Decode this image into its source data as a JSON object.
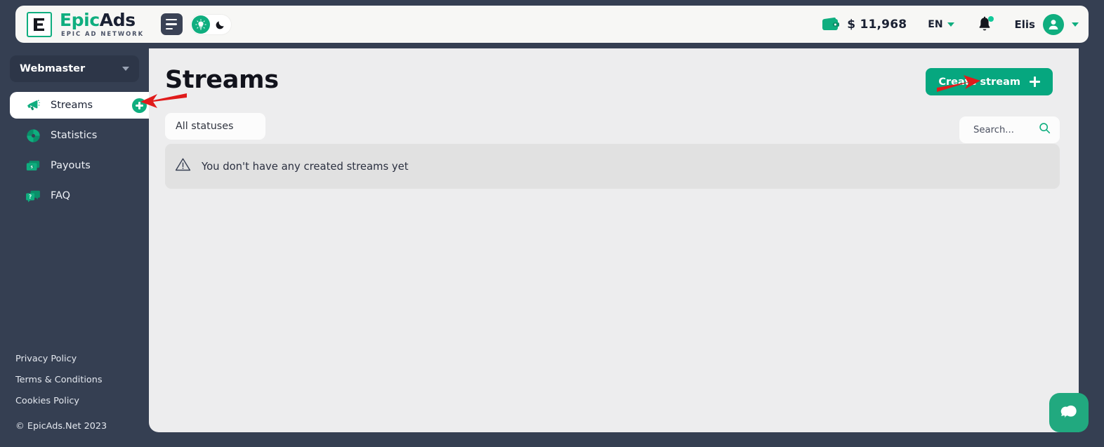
{
  "header": {
    "logo": {
      "mark_icon": "epicads-e-logo-icon",
      "word_primary": "Epic",
      "word_secondary": "Ads",
      "subtitle": "EPIC AD NETWORK"
    },
    "menu_toggle_icon": "hamburger-menu-icon",
    "theme_toggle": {
      "light_icon": "lightbulb-icon",
      "dark_icon": "moon-icon",
      "active": "light"
    },
    "wallet_icon": "wallet-icon",
    "balance": "$ 11,968",
    "language": "EN",
    "language_chevron_icon": "chevron-down-icon",
    "notifications_icon": "bell-icon",
    "notifications_has_unread": true,
    "user_name": "Elis",
    "avatar_icon": "user-avatar-icon",
    "user_chevron_icon": "chevron-down-icon"
  },
  "sidebar": {
    "role": "Webmaster",
    "role_chevron_icon": "chevron-down-icon",
    "items": [
      {
        "label": "Streams",
        "icon": "megaphone-icon",
        "active": true,
        "has_add_button": true
      },
      {
        "label": "Statistics",
        "icon": "pie-chart-icon",
        "active": false,
        "has_add_button": false
      },
      {
        "label": "Payouts",
        "icon": "banknotes-icon",
        "active": false,
        "has_add_button": false
      },
      {
        "label": "FAQ",
        "icon": "chat-question-icon",
        "active": false,
        "has_add_button": false
      }
    ],
    "add_stream_icon": "plus-icon",
    "footer_links": [
      "Privacy Policy",
      "Terms & Conditions",
      "Cookies Policy"
    ],
    "copyright": "© EpicAds.Net 2023"
  },
  "main": {
    "title": "Streams",
    "create_button": {
      "label": "Create stream",
      "icon": "plus-icon"
    },
    "status_filter": {
      "selected": "All statuses"
    },
    "search": {
      "value": "",
      "placeholder": "Search...",
      "icon": "search-icon"
    },
    "empty_state": {
      "icon": "warning-triangle-icon",
      "message": "You don't have any created streams yet"
    }
  },
  "chat": {
    "icon": "chat-bubbles-icon"
  },
  "annotations": {
    "arrows": [
      {
        "name": "arrow-to-sidebar-add-stream",
        "color": "#e01b1b"
      },
      {
        "name": "arrow-to-create-stream-button",
        "color": "#e01b1b"
      }
    ]
  },
  "colors": {
    "accent": "#0fae7f",
    "accent_button": "#06a77f",
    "sidebar_bg": "#353f52",
    "content_bg": "#ededee",
    "empty_card_bg": "#e1e1e1",
    "text_dark": "#1a2133",
    "annotation_red": "#e01b1b"
  }
}
